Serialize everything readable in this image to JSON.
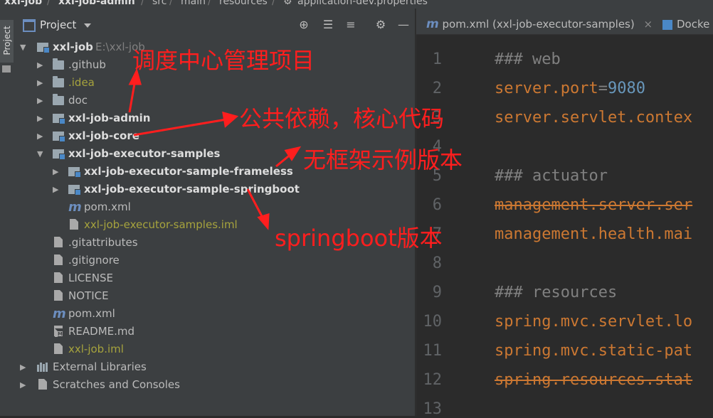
{
  "breadcrumb": [
    "xxl-job",
    "xxl-job-admin",
    "src",
    "main",
    "resources",
    "application-dev.properties"
  ],
  "stripe": {
    "tab_label": "Project"
  },
  "panel": {
    "title": "Project"
  },
  "tree": [
    {
      "label": "xxl-job",
      "path": "E:\\xxl-job",
      "icon": "module-icon",
      "expanded": true
    },
    {
      "label": ".github",
      "icon": "folder-icon"
    },
    {
      "label": ".idea",
      "icon": "folder-icon"
    },
    {
      "label": "doc",
      "icon": "folder-icon"
    },
    {
      "label": "xxl-job-admin",
      "icon": "module-icon"
    },
    {
      "label": "xxl-job-core",
      "icon": "module-icon"
    },
    {
      "label": "xxl-job-executor-samples",
      "icon": "module-icon",
      "expanded": true
    },
    {
      "label": "xxl-job-executor-sample-frameless",
      "icon": "module-icon"
    },
    {
      "label": "xxl-job-executor-sample-springboot",
      "icon": "module-icon"
    },
    {
      "label": "pom.xml",
      "icon": "maven-icon"
    },
    {
      "label": "xxl-job-executor-samples.iml",
      "icon": "iml-file-icon"
    },
    {
      "label": ".gitattributes",
      "icon": "file-icon"
    },
    {
      "label": ".gitignore",
      "icon": "file-icon"
    },
    {
      "label": "LICENSE",
      "icon": "file-icon"
    },
    {
      "label": "NOTICE",
      "icon": "file-icon"
    },
    {
      "label": "pom.xml",
      "icon": "maven-icon"
    },
    {
      "label": "README.md",
      "icon": "markdown-icon"
    },
    {
      "label": "xxl-job.iml",
      "icon": "iml-file-icon"
    },
    {
      "label": "External Libraries",
      "icon": "library-icon"
    },
    {
      "label": "Scratches and Consoles",
      "icon": "scratches-icon"
    }
  ],
  "annotations": {
    "admin": "调度中心管理项目",
    "core": "公共依赖，核心代码",
    "frameless": "无框架示例版本",
    "springboot": "springboot版本"
  },
  "editor": {
    "tabs": [
      {
        "m": "m",
        "label": "pom.xml (xxl-job-executor-samples)",
        "close": "×"
      },
      {
        "label": "Docke"
      }
    ],
    "lines": [
      {
        "num": "1",
        "parts": [
          "### web"
        ]
      },
      {
        "num": "2",
        "parts": [
          "server.port",
          "=",
          "9080"
        ]
      },
      {
        "num": "3",
        "parts": [
          "server.servlet.contex"
        ]
      },
      {
        "num": "4",
        "parts": []
      },
      {
        "num": "5",
        "parts": [
          "### actuator"
        ]
      },
      {
        "num": "6",
        "parts": [
          "management.server.ser"
        ]
      },
      {
        "num": "7",
        "parts": [
          "management.health.mai"
        ]
      },
      {
        "num": "8",
        "parts": []
      },
      {
        "num": "9",
        "parts": [
          "### resources"
        ]
      },
      {
        "num": "10",
        "parts": [
          "spring.mvc.servlet.lo"
        ]
      },
      {
        "num": "11",
        "parts": [
          "spring.mvc.static-pat"
        ]
      },
      {
        "num": "12",
        "parts": [
          "spring.resources.stat"
        ]
      },
      {
        "num": "13",
        "parts": []
      }
    ]
  },
  "colors": {
    "annotation": "#ff1e1e",
    "key": "#cc7832",
    "number": "#6897bb",
    "comment": "#808080"
  }
}
